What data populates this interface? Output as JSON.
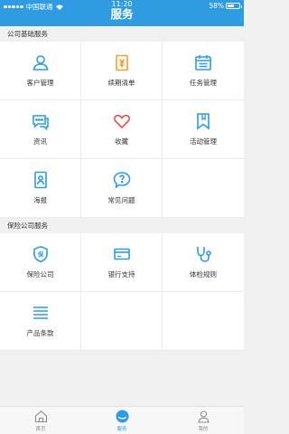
{
  "status_bar": {
    "carrier": "中国联通",
    "time": "11:20",
    "battery_percent": "58%",
    "battery_level": 0.58
  },
  "header": {
    "title": "服务"
  },
  "sections": {
    "public": {
      "title": "公司基础服务",
      "items": [
        {
          "label": "客户管理",
          "icon": "user-icon"
        },
        {
          "label": "续期清单",
          "icon": "renewal-list-icon"
        },
        {
          "label": "任务管理",
          "icon": "calendar-icon"
        },
        {
          "label": "资讯",
          "icon": "news-icon"
        },
        {
          "label": "收藏",
          "icon": "heart-icon"
        },
        {
          "label": "活动管理",
          "icon": "bookmark-icon"
        },
        {
          "label": "海报",
          "icon": "poster-icon"
        },
        {
          "label": "常见问题",
          "icon": "question-icon"
        }
      ]
    },
    "insurance": {
      "title": "保险公司服务",
      "items": [
        {
          "label": "保险公司",
          "icon": "insurance-shield-icon"
        },
        {
          "label": "银行支持",
          "icon": "bank-card-icon"
        },
        {
          "label": "体检规则",
          "icon": "stethoscope-icon"
        },
        {
          "label": "产品条款",
          "icon": "list-lines-icon"
        }
      ]
    }
  },
  "tabbar": {
    "tabs": [
      {
        "label": "首页",
        "icon": "home-icon",
        "active": false
      },
      {
        "label": "服务",
        "icon": "service-icon",
        "active": true
      },
      {
        "label": "我的",
        "icon": "profile-icon",
        "active": false
      }
    ]
  },
  "colors": {
    "primary": "#2f9be0",
    "icon_orange": "#f0a22e",
    "icon_red": "#e8504f",
    "background": "#f0f0f0"
  }
}
